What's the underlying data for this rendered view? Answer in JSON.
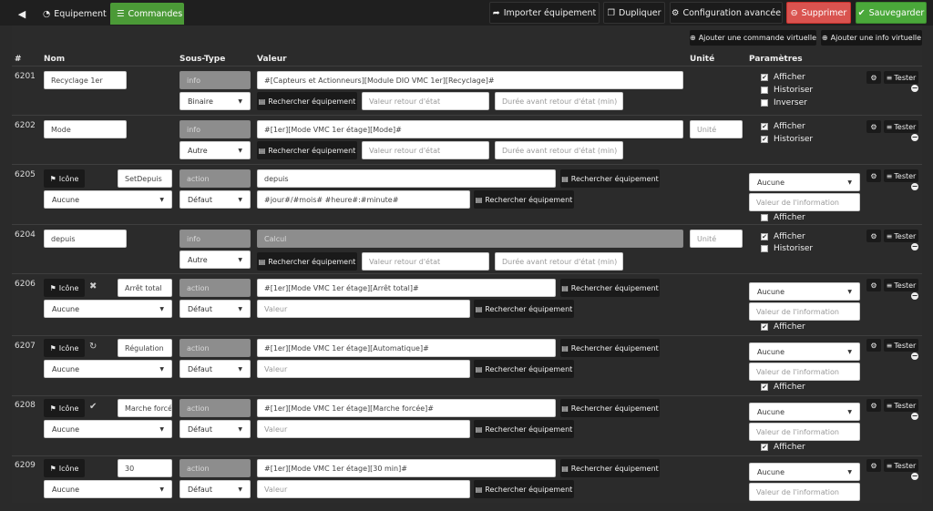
{
  "toolbar": {
    "back_icon": "circle-arrow-left-icon",
    "tab_equipement": "Equipement",
    "tab_commandes": "Commandes",
    "import_label": "Importer équipement",
    "duplicate_label": "Dupliquer",
    "advanced_label": "Configuration avancée",
    "delete_label": "Supprimer",
    "save_label": "Sauvegarder"
  },
  "actions": {
    "add_virtual_cmd": "Ajouter une commande virtuelle",
    "add_virtual_info": "Ajouter une info virtuelle"
  },
  "headers": {
    "hash": "#",
    "nom": "Nom",
    "soustype": "Sous-Type",
    "valeur": "Valeur",
    "unite": "Unité",
    "parametres": "Paramètres"
  },
  "common": {
    "rechercher": "Rechercher équipement",
    "valeur_retour": "Valeur retour d'état",
    "duree_retour": "Durée avant retour d'état (min)",
    "unite_ph": "Unité",
    "icone": "Icône",
    "aucune": "Aucune",
    "defaut": "Défaut",
    "valeur_ph": "Valeur",
    "valeur_info_ph": "Valeur de l'information",
    "afficher": "Afficher",
    "historiser": "Historiser",
    "inverser": "Inverser",
    "tester": "Tester",
    "info": "info",
    "action": "action",
    "binaire": "Binaire",
    "autre": "Autre",
    "calcul": "Calcul"
  },
  "rows": [
    {
      "id": "6201",
      "name": "Recyclage 1er",
      "value": "#[Capteurs et Actionneurs][Module DIO VMC 1er][Recyclage]#"
    },
    {
      "id": "6202",
      "name": "Mode",
      "value": "#[1er][Mode VMC 1er étage][Mode]#"
    },
    {
      "id": "6205",
      "name": "SetDepuis",
      "value": "depuis",
      "value2": "#jour#/#mois# #heure#:#minute#"
    },
    {
      "id": "6204",
      "name": "depuis"
    },
    {
      "id": "6206",
      "name": "Arrêt total",
      "value": "#[1er][Mode VMC 1er étage][Arrêt total]#",
      "icon": "close-icon"
    },
    {
      "id": "6207",
      "name": "Régulation",
      "value": "#[1er][Mode VMC 1er étage][Automatique]#",
      "icon": "refresh-icon"
    },
    {
      "id": "6208",
      "name": "Marche forcé",
      "value": "#[1er][Mode VMC 1er étage][Marche forcée]#",
      "icon": "check-icon"
    },
    {
      "id": "6209",
      "name": "30",
      "value": "#[1er][Mode VMC 1er étage][30 min]#"
    }
  ]
}
